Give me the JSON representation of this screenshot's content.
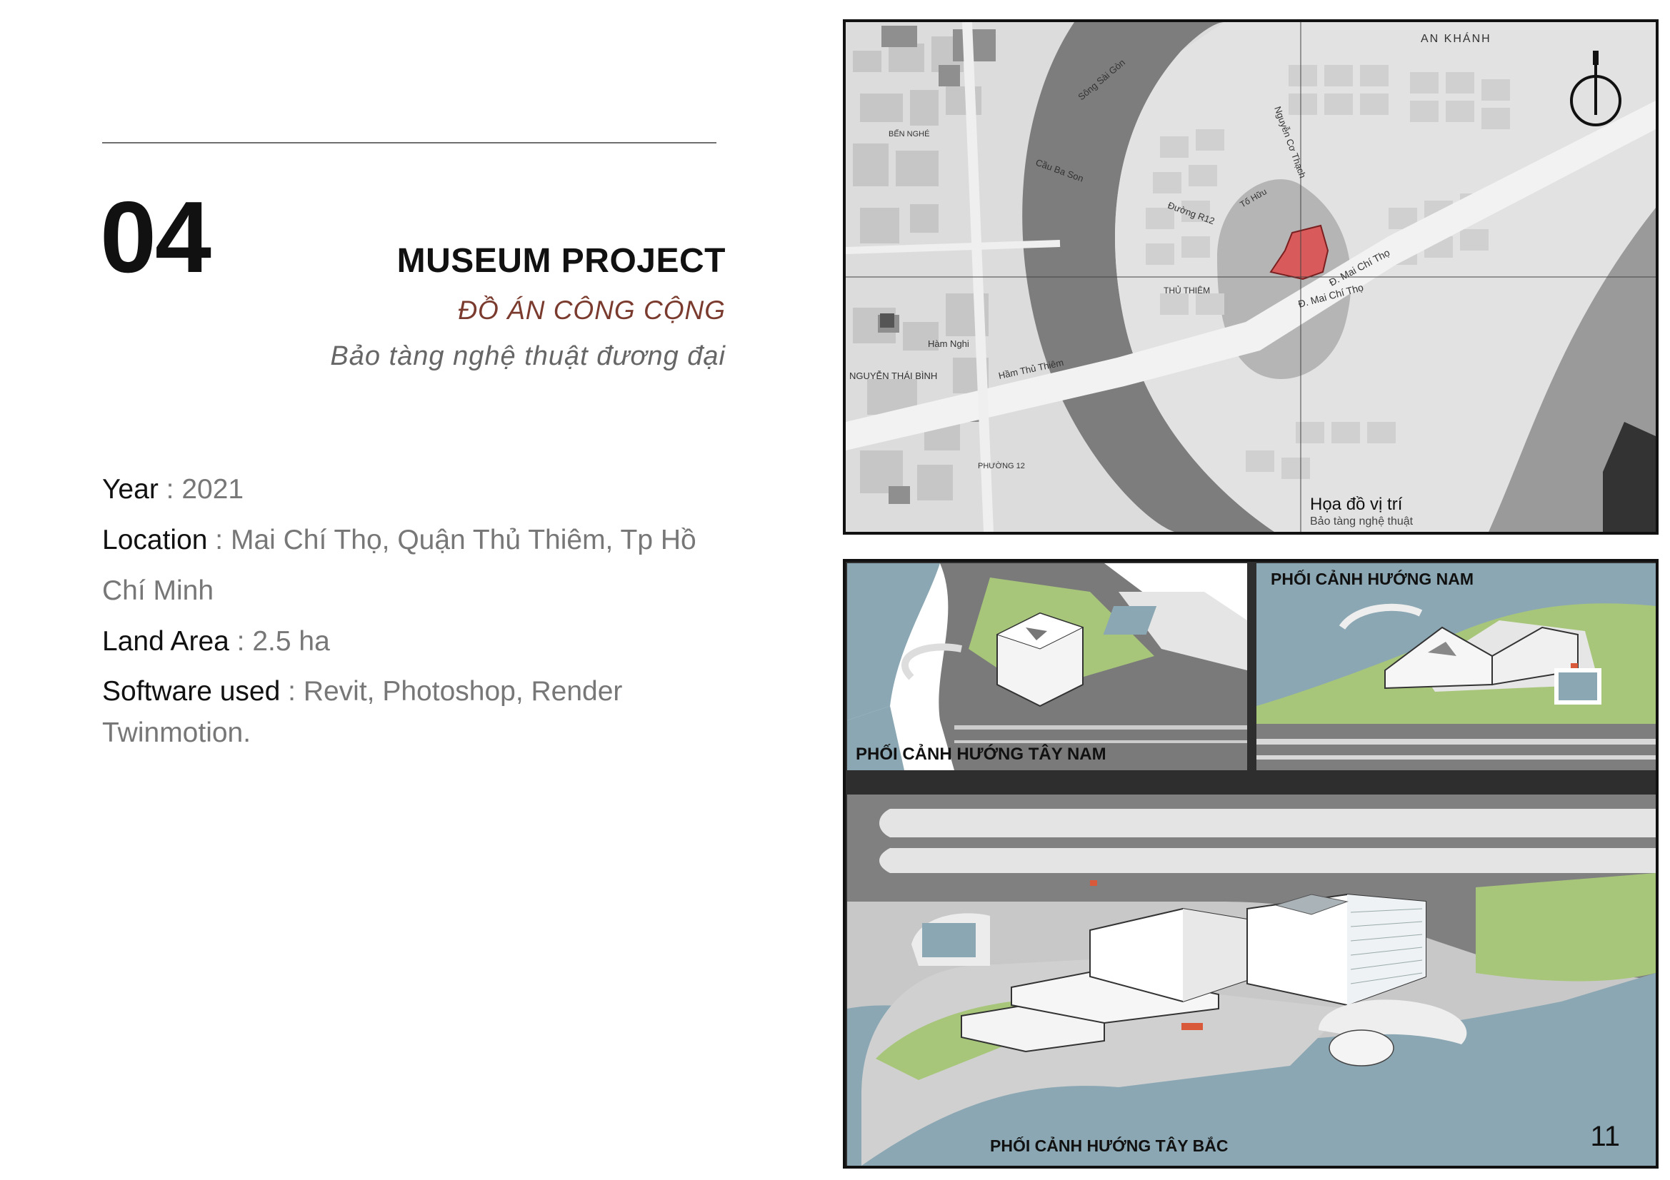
{
  "project": {
    "number": "04",
    "title": "MUSEUM PROJECT",
    "subtitle": "ĐỒ ÁN CÔNG CỘNG",
    "description": "Bảo tàng nghệ thuật đương đại"
  },
  "info": {
    "year_label": "Year",
    "year_value": " : 2021",
    "location_label": "Location",
    "location_value": " : Mai Chí Thọ, Quận Thủ Thiêm, Tp Hồ Chí Minh",
    "land_label": "Land Area",
    "land_value": " : 2.5 ha",
    "software_label": "Software used",
    "software_value": " : Revit, Photoshop, Render Twinmotion."
  },
  "map": {
    "caption_title": "Họa đồ vị trí",
    "caption_sub": "Bảo tàng nghệ thuật",
    "labels": {
      "an_khanh": "AN KHÁNH",
      "mai_chi_tho_1": "Đ. Mai Chí Thọ",
      "mai_chi_tho_2": "Đ. Mai Chí Thọ",
      "duong_r12": "Đường R12",
      "ham_nghi": "Hàm Nghi",
      "nguyen_co_thach": "Nguyễn Cơ Thạch",
      "to_huu": "Tố Hữu",
      "thu_thiem": "THỦ THIÊM",
      "cau_ba_son": "Cầu Ba Son",
      "song_sai_gon": "Sông Sài Gòn",
      "ham_thu_thiem": "Hầm Thủ Thiêm",
      "ben_nghe": "BẾN NGHÉ",
      "phuong_12": "PHƯỜNG 12",
      "nguyen_thai_binh": "NGUYỄN THÁI BÌNH"
    },
    "icon": "north-arrow-icon"
  },
  "renders": {
    "southwest": "PHỐI CẢNH HƯỚNG TÂY NAM",
    "south": "PHỐI CẢNH HƯỚNG NAM",
    "northwest": "PHỐI CẢNH HƯỚNG TÂY BẮC",
    "page_number": "11"
  },
  "colors": {
    "accent_red": "#d85a5a",
    "subtitle_brown": "#7a3b2e",
    "water": "#8aa7b3",
    "grass": "#a7c67a"
  }
}
